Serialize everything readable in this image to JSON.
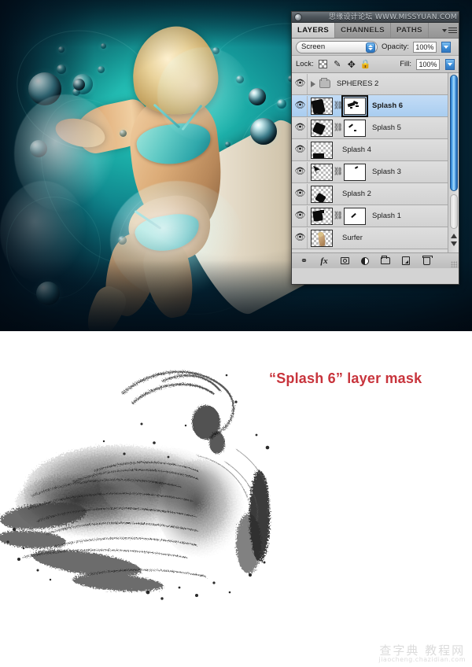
{
  "watermarks": {
    "top": "思缘设计论坛  WWW.MISSYUAN.COM",
    "bottom_cn": "查字典 教程网",
    "bottom_url": "jiaocheng.chazidian.com"
  },
  "photo": {
    "alt": "Surfer girl running with surfboard on teal underwater background"
  },
  "panel": {
    "tabs": [
      {
        "label": "LAYERS",
        "active": true
      },
      {
        "label": "CHANNELS",
        "active": false
      },
      {
        "label": "PATHS",
        "active": false
      }
    ],
    "blend": {
      "mode": "Screen",
      "opacity_label": "Opacity:",
      "opacity_value": "100%"
    },
    "lock": {
      "label": "Lock:",
      "icons": [
        "lock-transparency-icon",
        "lock-image-icon",
        "lock-position-icon",
        "lock-all-icon"
      ],
      "fill_label": "Fill:",
      "fill_value": "100%"
    },
    "layers": [
      {
        "name": "SPHERES 2",
        "type": "group",
        "visible": true,
        "selected": false,
        "has_mask": false,
        "bold": false
      },
      {
        "name": "Splash 6",
        "type": "layer",
        "visible": true,
        "selected": true,
        "has_mask": true,
        "bold": true,
        "mask_active": true
      },
      {
        "name": "Splash 5",
        "type": "layer",
        "visible": true,
        "selected": false,
        "has_mask": true,
        "bold": false,
        "mask_active": false
      },
      {
        "name": "Splash 4",
        "type": "layer",
        "visible": true,
        "selected": false,
        "has_mask": false,
        "bold": false
      },
      {
        "name": "Splash 3",
        "type": "layer",
        "visible": true,
        "selected": false,
        "has_mask": true,
        "bold": false,
        "mask_active": false
      },
      {
        "name": "Splash 2",
        "type": "layer",
        "visible": true,
        "selected": false,
        "has_mask": false,
        "bold": false
      },
      {
        "name": "Splash 1",
        "type": "layer",
        "visible": true,
        "selected": false,
        "has_mask": true,
        "bold": false,
        "mask_active": false
      },
      {
        "name": "Surfer",
        "type": "layer",
        "visible": true,
        "selected": false,
        "has_mask": false,
        "bold": false
      }
    ],
    "footer_icons": [
      "link-layers-icon",
      "layer-style-fx-icon",
      "add-layer-mask-icon",
      "adjustment-layer-icon",
      "new-group-icon",
      "new-layer-icon",
      "delete-layer-icon"
    ],
    "footer_fx_label": "fx"
  },
  "caption": {
    "text": "“Splash 6” layer mask",
    "color": "#c8343c"
  },
  "colors": {
    "accent_teal": "#19a7a3",
    "panel_gray": "#d3d3d3",
    "selected_row": "#a9cdf0",
    "scrollbar_blue": "#4c9ae2",
    "caption_red": "#c8343c"
  }
}
